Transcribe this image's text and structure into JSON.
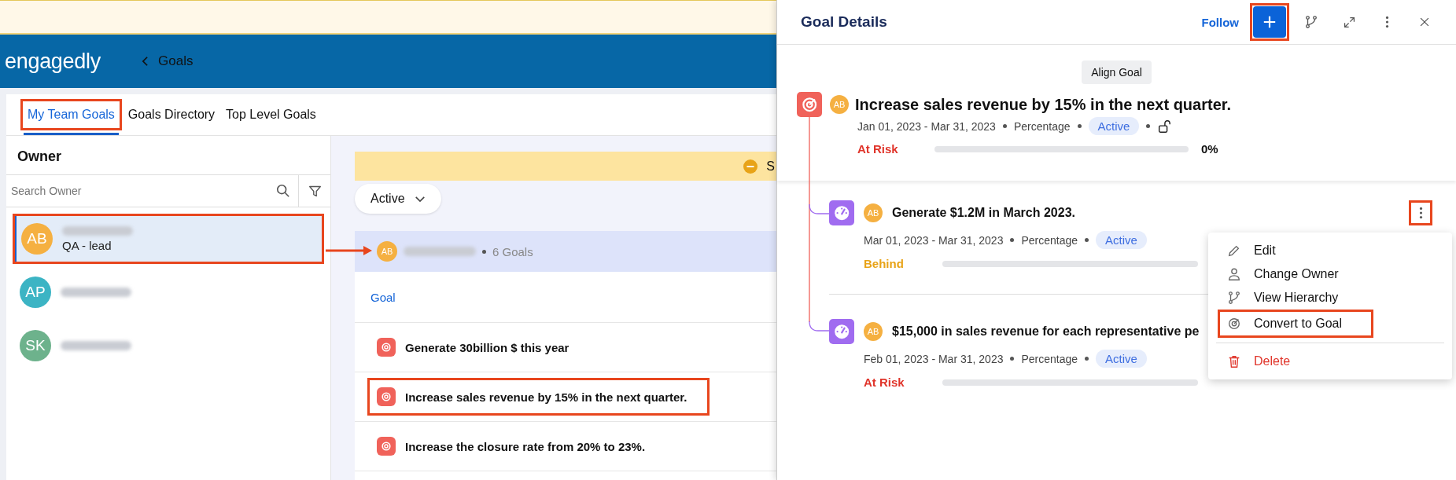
{
  "header": {
    "logo": "engagedly",
    "back_label": "Goals"
  },
  "tabs": [
    {
      "label": "My Team Goals",
      "selected": true,
      "highlighted": true
    },
    {
      "label": "Goals Directory",
      "selected": false,
      "highlighted": false
    },
    {
      "label": "Top Level Goals",
      "selected": false,
      "highlighted": false
    }
  ],
  "owner_panel": {
    "title": "Owner",
    "search": {
      "placeholder": "Search Owner"
    },
    "owners": [
      {
        "initials": "AB",
        "role": "QA - lead",
        "color": "#f5b041",
        "selected": true,
        "highlighted": true
      },
      {
        "initials": "AP",
        "color": "#3cb4c4",
        "selected": false,
        "highlighted": false
      },
      {
        "initials": "SK",
        "color": "#6db28c",
        "selected": false,
        "highlighted": false
      }
    ]
  },
  "goals_panel": {
    "notice": "S",
    "filter": "Active",
    "group": {
      "initials": "AB",
      "count": "6 Goals"
    },
    "column": "Goal",
    "goals": [
      {
        "title": "Generate 30billion $ this year",
        "highlighted": false
      },
      {
        "title": "Increase sales revenue by 15% in the next quarter.",
        "highlighted": true
      },
      {
        "title": "Increase the closure rate from 20% to 23%.",
        "highlighted": false
      }
    ]
  },
  "details": {
    "title": "Goal Details",
    "follow": "Follow",
    "add_highlighted": true,
    "align_button": "Align Goal",
    "goal": {
      "kind": "goal",
      "initials": "AB",
      "title": "Increase sales revenue by 15% in the next quarter.",
      "dates": "Jan 01, 2023 - Mar 31, 2023",
      "metric": "Percentage",
      "state": "Active",
      "locked": false,
      "status": {
        "label": "At Risk",
        "kind": "at_risk"
      },
      "level": 0,
      "progress": "0%"
    },
    "key_results": [
      {
        "kind": "key_result",
        "initials": "AB",
        "title": "Generate $1.2M in March 2023.",
        "dates": "Mar 01, 2023 - Mar 31, 2023",
        "metric": "Percentage",
        "state": "Active",
        "status": {
          "label": "Behind",
          "kind": "behind"
        },
        "level": 0,
        "menu_open": true,
        "highlighted": true
      },
      {
        "kind": "key_result",
        "initials": "AB",
        "title": "$15,000 in sales revenue for each representative pe",
        "dates": "Feb 01, 2023 - Mar 31, 2023",
        "metric": "Percentage",
        "state": "Active",
        "status": {
          "label": "At Risk",
          "kind": "at_risk"
        },
        "level": 0,
        "menu_open": false
      }
    ],
    "menu": [
      {
        "label": "Edit",
        "kind": "edit",
        "highlighted": false
      },
      {
        "label": "Change Owner",
        "kind": "owner",
        "highlighted": false
      },
      {
        "label": "View Hierarchy",
        "kind": "hierarchy",
        "highlighted": false
      },
      {
        "label": "Convert to Goal",
        "kind": "convert",
        "highlighted": true
      },
      {
        "label": "Delete",
        "kind": "delete",
        "highlighted": false
      }
    ]
  }
}
